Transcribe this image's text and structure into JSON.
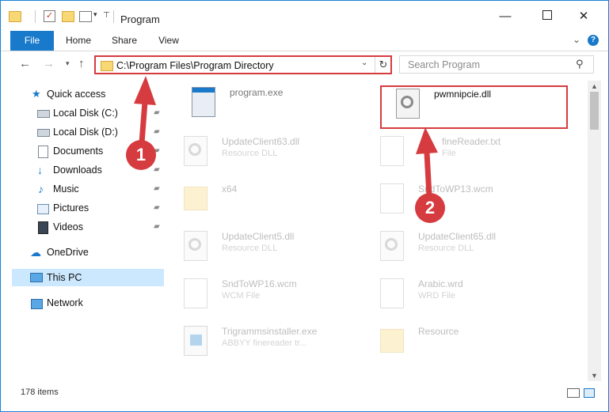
{
  "window": {
    "title": "Program",
    "minimize_glyph": "—",
    "close_glyph": "✕"
  },
  "quick_access_toolbar": {
    "undo_glyph": "▾",
    "pin_glyph": "⊤"
  },
  "ribbon": {
    "tabs": [
      {
        "label": "File",
        "active": true
      },
      {
        "label": "Home"
      },
      {
        "label": "Share"
      },
      {
        "label": "View"
      }
    ],
    "collapse_glyph": "⌄",
    "help_glyph": "?"
  },
  "navigation": {
    "back_glyph": "←",
    "forward_glyph": "→",
    "recent_glyph": "▾",
    "up_glyph": "↑",
    "address": "C:\\Program Files\\Program Directory",
    "address_dropdown_glyph": "⌄",
    "refresh_glyph": "↻",
    "search_placeholder": "Search Program",
    "search_glyph": "⚲"
  },
  "nav_pane": {
    "items": [
      {
        "label": "Quick access",
        "icon": "star-icon"
      },
      {
        "label": "Local Disk (C:)",
        "icon": "disk-icon",
        "pinned": true
      },
      {
        "label": "Local Disk (D:)",
        "icon": "disk-icon",
        "pinned": true
      },
      {
        "label": "Documents",
        "icon": "documents-icon",
        "pinned": true
      },
      {
        "label": "Downloads",
        "icon": "downloads-icon",
        "pinned": true
      },
      {
        "label": "Music",
        "icon": "music-icon",
        "pinned": true
      },
      {
        "label": "Pictures",
        "icon": "pictures-icon",
        "pinned": true
      },
      {
        "label": "Videos",
        "icon": "videos-icon",
        "pinned": true
      },
      {
        "label": "OneDrive",
        "icon": "onedrive-icon"
      },
      {
        "label": "This PC",
        "icon": "pc-icon",
        "selected": true
      },
      {
        "label": "Network",
        "icon": "network-icon"
      }
    ],
    "pin_glyph": "📌"
  },
  "files": [
    {
      "name": "program.exe",
      "type": "",
      "icon": "exe-icon"
    },
    {
      "name": "pwmnipcie.dll",
      "type": "",
      "icon": "dll-icon",
      "highlighted": true
    },
    {
      "name": "UpdateClient63.dll",
      "type": "Resource DLL",
      "icon": "dll-icon"
    },
    {
      "name": "fineReader.txt",
      "type": "File",
      "icon": "doc-icon"
    },
    {
      "name": "x64",
      "type": "",
      "icon": "folder-icon"
    },
    {
      "name": "SndToWP13.wcm",
      "type": "File",
      "icon": "doc-icon"
    },
    {
      "name": "UpdateClient5.dll",
      "type": "Resource DLL",
      "icon": "dll-icon"
    },
    {
      "name": "UpdateClient65.dll",
      "type": "Resource DLL",
      "icon": "dll-icon"
    },
    {
      "name": "SndToWP16.wcm",
      "type": "WCM File",
      "icon": "doc-icon"
    },
    {
      "name": "Arabic.wrd",
      "type": "WRD File",
      "icon": "doc-icon"
    },
    {
      "name": "Trigrammsinstaller.exe",
      "type": "ABBYY finereader tr...",
      "icon": "installer-icon"
    },
    {
      "name": "Resource",
      "type": "",
      "icon": "folder-icon"
    }
  ],
  "status": {
    "item_count": "178 items"
  },
  "annotations": {
    "step1": "1",
    "step2": "2",
    "color": "#d63b3f"
  },
  "colors": {
    "accent": "#1979ca",
    "highlight_red": "#d63b3f",
    "selection": "#cce8ff"
  }
}
